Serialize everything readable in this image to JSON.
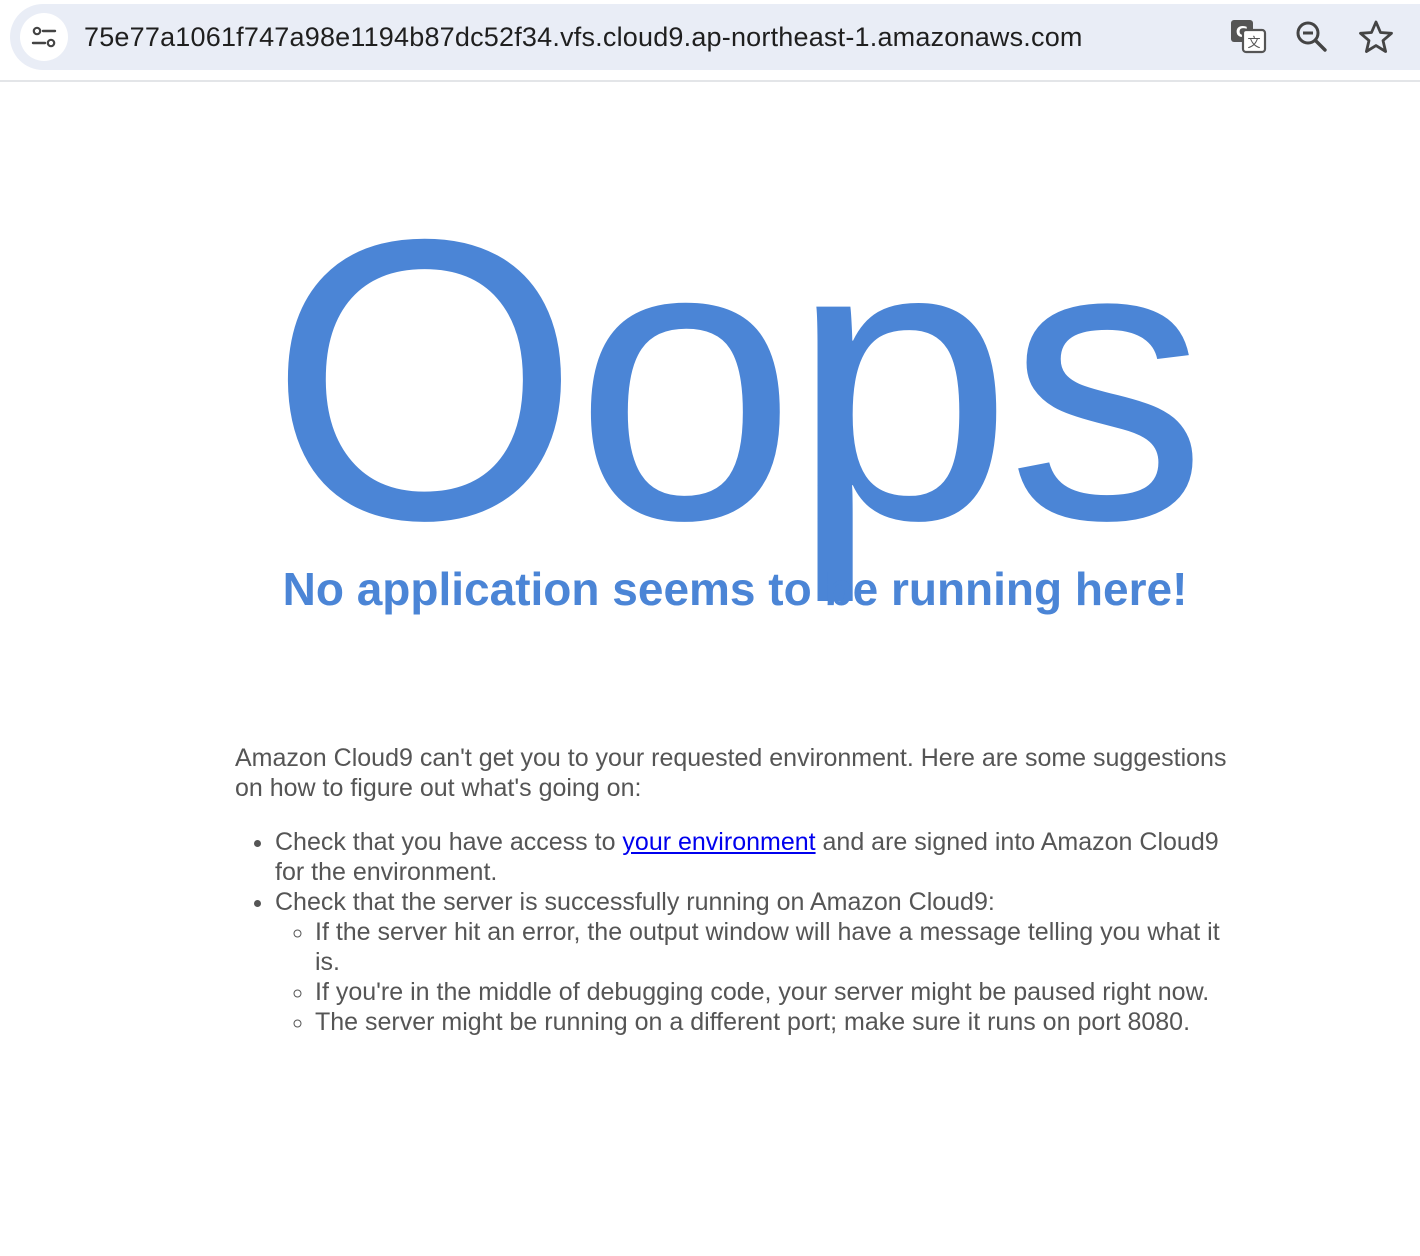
{
  "browser": {
    "url": "75e77a1061f747a98e1194b87dc52f34.vfs.cloud9.ap-northeast-1.amazonaws.com",
    "icons": [
      "site-settings-icon",
      "translate-icon",
      "zoom-icon",
      "star-icon"
    ]
  },
  "page": {
    "headline": "Oops",
    "subtitle": "No application seems to be running here!",
    "intro": "Amazon Cloud9 can't get you to your requested environment. Here are some suggestions on how to figure out what's going on:",
    "items": [
      {
        "before_link": "Check that you have access to ",
        "link_text": "your environment",
        "after_link": " and are signed into Amazon Cloud9 for the environment."
      },
      {
        "text": "Check that the server is successfully running on Amazon Cloud9:",
        "subitems": [
          "If the server hit an error, the output window will have a message telling you what it is.",
          "If you're in the middle of debugging code, your server might be paused right now.",
          "The server might be running on a different port; make sure it runs on port 8080."
        ]
      }
    ]
  },
  "colors": {
    "accent": "#4b85d6",
    "body_text": "#555555",
    "link": "#0000ee",
    "omnibox_bg": "#e9edf6"
  }
}
